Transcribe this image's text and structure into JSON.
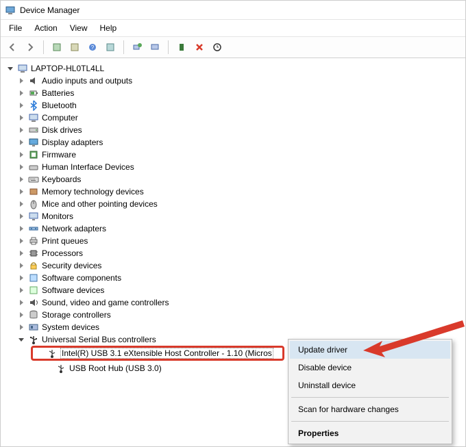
{
  "window": {
    "title": "Device Manager"
  },
  "menubar": [
    "File",
    "Action",
    "View",
    "Help"
  ],
  "toolbar_icons": [
    "back-icon",
    "forward-icon",
    "sep",
    "up-icon",
    "show-hidden-icon",
    "properties-icon",
    "refresh-icon",
    "sep",
    "monitor1-icon",
    "monitor2-icon",
    "sep",
    "device-add-icon",
    "uninstall-icon",
    "scan-hardware-icon"
  ],
  "root": "LAPTOP-HL0TL4LL",
  "categories": [
    {
      "icon": "audio-icon",
      "label": "Audio inputs and outputs"
    },
    {
      "icon": "battery-icon",
      "label": "Batteries"
    },
    {
      "icon": "bluetooth-icon",
      "label": "Bluetooth"
    },
    {
      "icon": "computer-icon",
      "label": "Computer"
    },
    {
      "icon": "disk-icon",
      "label": "Disk drives"
    },
    {
      "icon": "display-icon",
      "label": "Display adapters"
    },
    {
      "icon": "firmware-icon",
      "label": "Firmware"
    },
    {
      "icon": "hid-icon",
      "label": "Human Interface Devices"
    },
    {
      "icon": "keyboard-icon",
      "label": "Keyboards"
    },
    {
      "icon": "memtech-icon",
      "label": "Memory technology devices"
    },
    {
      "icon": "mouse-icon",
      "label": "Mice and other pointing devices"
    },
    {
      "icon": "monitor-icon",
      "label": "Monitors"
    },
    {
      "icon": "network-icon",
      "label": "Network adapters"
    },
    {
      "icon": "print-icon",
      "label": "Print queues"
    },
    {
      "icon": "cpu-icon",
      "label": "Processors"
    },
    {
      "icon": "security-icon",
      "label": "Security devices"
    },
    {
      "icon": "softcomp-icon",
      "label": "Software components"
    },
    {
      "icon": "softdev-icon",
      "label": "Software devices"
    },
    {
      "icon": "sound-icon",
      "label": "Sound, video and game controllers"
    },
    {
      "icon": "storage-icon",
      "label": "Storage controllers"
    },
    {
      "icon": "system-icon",
      "label": "System devices"
    }
  ],
  "usb_category": {
    "icon": "usb-icon",
    "label": "Universal Serial Bus controllers"
  },
  "usb_children": [
    {
      "icon": "usb-device-icon",
      "label": "Intel(R) USB 3.1 eXtensible Host Controller - 1.10 (Micros",
      "selected": true
    },
    {
      "icon": "usb-device-icon",
      "label": "USB Root Hub (USB 3.0)",
      "selected": false
    }
  ],
  "context_menu": {
    "update": "Update driver",
    "disable": "Disable device",
    "uninstall": "Uninstall device",
    "scan": "Scan for hardware changes",
    "properties": "Properties"
  }
}
